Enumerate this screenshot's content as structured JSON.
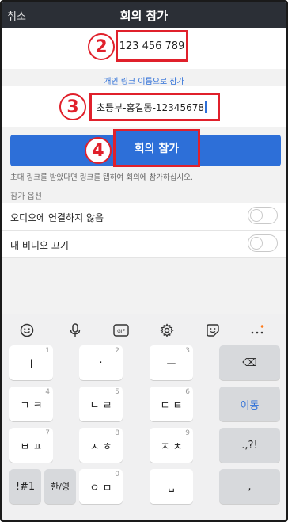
{
  "header": {
    "cancel_label": "취소",
    "title": "회의 참가"
  },
  "meeting_id": {
    "value": "123 456 789",
    "badge": "2"
  },
  "link_option": "개인 링크 이름으로 참가",
  "display_name": {
    "value": "초등부-홍길동-12345678",
    "badge": "3"
  },
  "join_button": {
    "label": "회의 참가",
    "badge": "4"
  },
  "hint_text": "초대 링크를 받았다면 링크를 탭하여 회의에 참가하십시오.",
  "options": {
    "section_label": "참가 옵션",
    "items": [
      {
        "label": "오디오에 연결하지 않음",
        "on": false
      },
      {
        "label": "내 비디오 끄기",
        "on": false
      }
    ]
  },
  "keyboard": {
    "toolbar": [
      "smiley-icon",
      "mic-icon",
      "gif-icon",
      "gear-icon",
      "sticker-icon",
      "more-icon"
    ],
    "gif_label": "GIF",
    "keys": [
      {
        "label": "ㅣ",
        "num": "1"
      },
      {
        "label": "·",
        "num": "2"
      },
      {
        "label": "ㅡ",
        "num": "3"
      },
      {
        "label": "⌫",
        "num": ""
      },
      {
        "label": "ㄱ ㅋ",
        "num": "4"
      },
      {
        "label": "ㄴ ㄹ",
        "num": "5"
      },
      {
        "label": "ㄷ ㅌ",
        "num": "6"
      },
      {
        "label": "이동",
        "num": ""
      },
      {
        "label": "ㅂ ㅍ",
        "num": "7"
      },
      {
        "label": "ㅅ ㅎ",
        "num": "8"
      },
      {
        "label": "ㅈ ㅊ",
        "num": "9"
      },
      {
        "label": ".,?!",
        "num": ""
      },
      {
        "label": "!#1",
        "num": ""
      },
      {
        "label": "한/영",
        "num": ""
      },
      {
        "label": "ㅇ ㅁ",
        "num": "0"
      },
      {
        "label": "␣",
        "num": ""
      },
      {
        "label": ",",
        "num": ""
      }
    ]
  }
}
